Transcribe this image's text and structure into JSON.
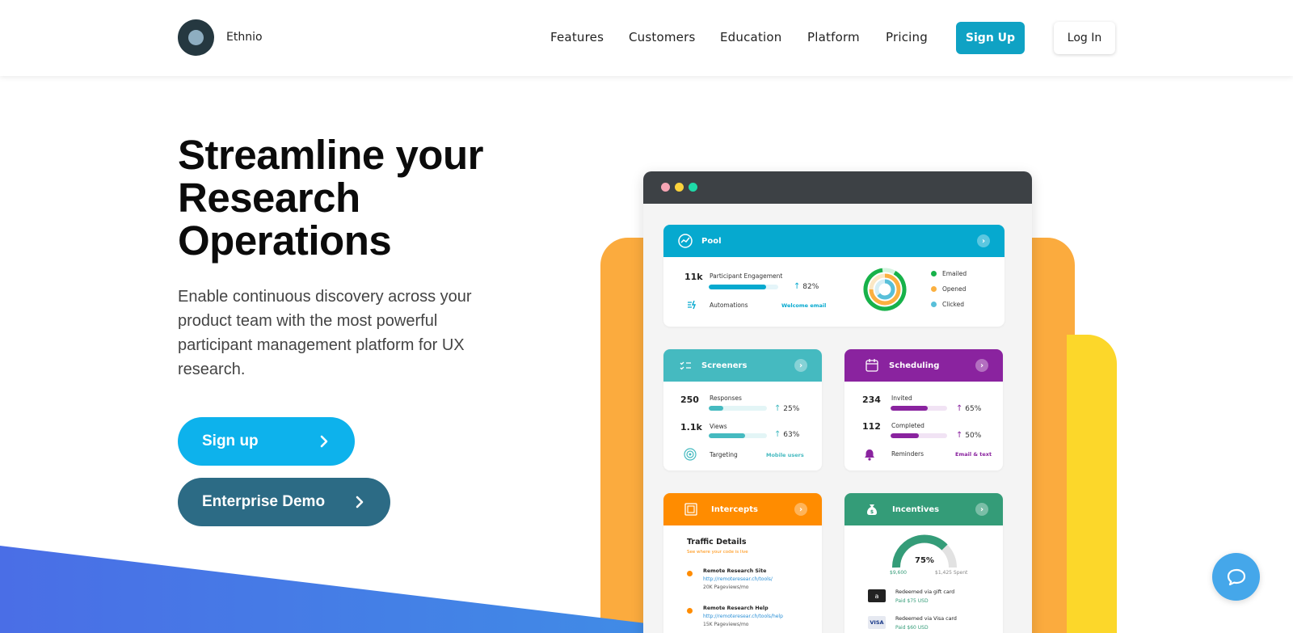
{
  "nav": {
    "brand": "Ethnio",
    "links": [
      "Features",
      "Customers",
      "Education",
      "Platform",
      "Pricing"
    ],
    "signup_label": "Sign Up",
    "login_label": "Log In"
  },
  "hero": {
    "headline": "Streamline your Research Operations",
    "lead": "Enable continuous discovery across your product team with the most powerful participant management platform for UX research.",
    "cta_signup": "Sign up",
    "cta_demo": "Enterprise Demo"
  },
  "mock": {
    "pool": {
      "title": "Pool",
      "count": "11k",
      "metric_label": "Participant Engagement",
      "metric_pct": "82%",
      "metric_value": 0.82,
      "automations_label": "Automations",
      "automations_link": "Welcome email",
      "legend": [
        "Emailed",
        "Opened",
        "Clicked"
      ]
    },
    "screeners": {
      "title": "Screeners",
      "rows": [
        {
          "count": "250",
          "label": "Responses",
          "pct": "25%",
          "value": 0.25
        },
        {
          "count": "1.1k",
          "label": "Views",
          "pct": "63%",
          "value": 0.63
        }
      ],
      "targeting_label": "Targeting",
      "targeting_link": "Mobile users"
    },
    "scheduling": {
      "title": "Scheduling",
      "rows": [
        {
          "count": "234",
          "label": "Invited",
          "pct": "65%",
          "value": 0.65
        },
        {
          "count": "112",
          "label": "Completed",
          "pct": "50%",
          "value": 0.5
        }
      ],
      "reminders_label": "Reminders",
      "reminders_link": "Email & text"
    },
    "intercepts": {
      "title": "Intercepts",
      "section_title": "Traffic Details",
      "section_sub": "See where your code is live",
      "items": [
        {
          "title": "Remote Research Site",
          "url": "http://remoteresear.ch/tools/",
          "views": "20K Pageviews/mo"
        },
        {
          "title": "Remote Research Help",
          "url": "http://remoteresear.ch/tools/help",
          "views": "15K Pageviews/mo"
        }
      ]
    },
    "incentives": {
      "title": "Incentives",
      "gauge_pct": "75%",
      "gauge_value": 0.75,
      "left_amount": "$9,600",
      "right_amount": "$1,425 Spent",
      "items": [
        {
          "title": "Redeemed via gift card",
          "sub": "Paid $75 USD",
          "card": "a"
        },
        {
          "title": "Redeemed via Visa card",
          "sub": "Paid $60 USD",
          "card": "VISA"
        }
      ]
    }
  },
  "colors": {
    "pool": "#06a9cf",
    "screeners": "#45bac0",
    "scheduling": "#8a239f",
    "intercepts": "#ff8c00",
    "incentives": "#349c78",
    "signup": "#0db2ec",
    "demo": "#2c6b85"
  }
}
